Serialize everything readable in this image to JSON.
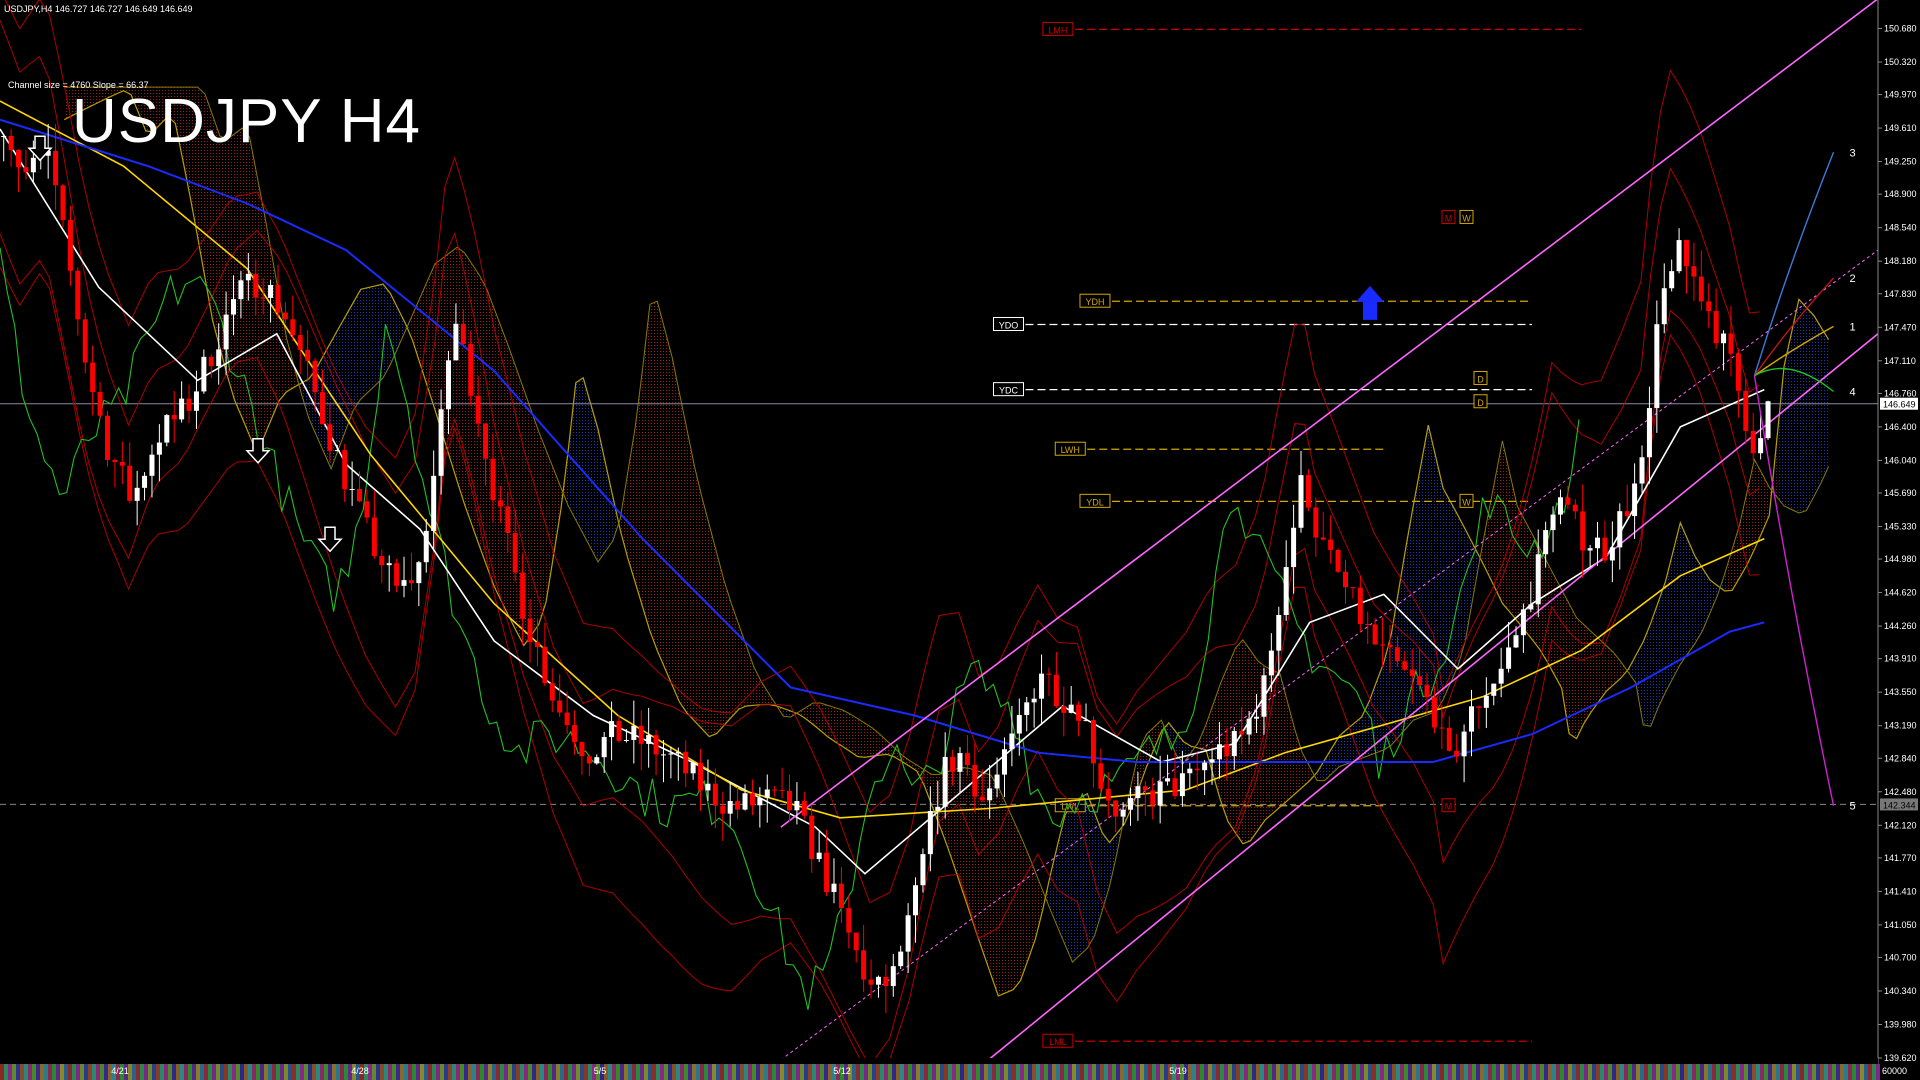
{
  "header": {
    "symbol_line": "USDJPY,H4  146.727 146.727 146.649 146.649",
    "channel_info": "Channel size = 4760 Slope = 66.37",
    "title": "USDJPY H4"
  },
  "colors": {
    "background": "#000000",
    "bull_candle": "#ffffff",
    "bear_candle": "#ff0000",
    "ema_white": "#ffffff",
    "ma_yellow": "#ffd700",
    "ma_blue": "#1a2bff",
    "bands_red": "#c00000",
    "chikou_green": "#22c022",
    "channel_magenta": "#ff66ff",
    "cloud_bull": "#1a3fcc",
    "cloud_bear": "#b02010",
    "level_red": "#cc0000",
    "level_gold": "#d4a800"
  },
  "chart_data": {
    "type": "candlestick",
    "symbol": "USDJPY",
    "timeframe": "H4",
    "ylim": [
      139.62,
      150.9
    ],
    "last_price": 146.649,
    "price_ticks": [
      "150.680",
      "150.320",
      "149.970",
      "149.610",
      "149.250",
      "148.900",
      "148.540",
      "148.180",
      "147.830",
      "147.470",
      "147.110",
      "146.760",
      "146.400",
      "146.040",
      "145.690",
      "145.330",
      "144.980",
      "144.620",
      "144.260",
      "143.910",
      "143.550",
      "143.190",
      "142.840",
      "142.480",
      "142.120",
      "141.770",
      "141.410",
      "141.050",
      "140.700",
      "140.340",
      "139.980",
      "139.620"
    ],
    "price_tag_current": "146.649",
    "price_tag_level": "142.344",
    "level_value": 142.344,
    "date_labels": [
      "4/21",
      "4/28",
      "5/5",
      "5/12",
      "5/19"
    ],
    "volume_label": "60000",
    "close_path": [
      [
        0,
        149.7
      ],
      [
        8,
        149.1
      ],
      [
        18,
        149.3
      ],
      [
        26,
        148.2
      ],
      [
        34,
        147.0
      ],
      [
        42,
        146.2
      ],
      [
        52,
        145.6
      ],
      [
        62,
        146.3
      ],
      [
        74,
        146.6
      ],
      [
        84,
        147.2
      ],
      [
        94,
        147.8
      ],
      [
        104,
        148.0
      ],
      [
        114,
        147.6
      ],
      [
        124,
        146.9
      ],
      [
        136,
        146.0
      ],
      [
        148,
        145.2
      ],
      [
        160,
        144.6
      ],
      [
        168,
        144.9
      ],
      [
        176,
        146.2
      ],
      [
        182,
        147.6
      ],
      [
        190,
        146.8
      ],
      [
        200,
        145.5
      ],
      [
        212,
        144.3
      ],
      [
        224,
        143.4
      ],
      [
        236,
        142.9
      ],
      [
        248,
        143.1
      ],
      [
        260,
        143.0
      ],
      [
        272,
        142.8
      ],
      [
        284,
        142.5
      ],
      [
        296,
        142.3
      ],
      [
        308,
        142.4
      ],
      [
        320,
        142.3
      ],
      [
        332,
        141.6
      ],
      [
        344,
        140.8
      ],
      [
        352,
        140.3
      ],
      [
        360,
        140.5
      ],
      [
        368,
        141.2
      ],
      [
        374,
        142.0
      ],
      [
        380,
        142.7
      ],
      [
        388,
        142.9
      ],
      [
        396,
        142.4
      ],
      [
        404,
        142.7
      ],
      [
        412,
        143.3
      ],
      [
        420,
        143.8
      ],
      [
        428,
        143.5
      ],
      [
        436,
        143.4
      ],
      [
        444,
        142.6
      ],
      [
        452,
        142.2
      ],
      [
        460,
        142.4
      ],
      [
        470,
        142.5
      ],
      [
        480,
        142.6
      ],
      [
        490,
        142.9
      ],
      [
        500,
        143.0
      ],
      [
        510,
        143.6
      ],
      [
        518,
        144.8
      ],
      [
        526,
        145.9
      ],
      [
        532,
        145.2
      ],
      [
        540,
        144.8
      ],
      [
        548,
        144.4
      ],
      [
        556,
        144.0
      ],
      [
        564,
        143.8
      ],
      [
        572,
        143.6
      ],
      [
        580,
        143.3
      ],
      [
        584,
        142.7
      ],
      [
        590,
        143.1
      ],
      [
        598,
        143.5
      ],
      [
        606,
        143.8
      ],
      [
        614,
        144.3
      ],
      [
        622,
        145.0
      ],
      [
        628,
        145.7
      ],
      [
        634,
        145.4
      ],
      [
        640,
        145.2
      ],
      [
        648,
        145.1
      ],
      [
        656,
        145.5
      ],
      [
        664,
        146.0
      ],
      [
        670,
        147.6
      ],
      [
        676,
        148.3
      ],
      [
        682,
        148.1
      ],
      [
        688,
        147.8
      ],
      [
        694,
        147.4
      ],
      [
        700,
        147.0
      ],
      [
        706,
        146.4
      ],
      [
        710,
        146.1
      ],
      [
        714,
        146.6
      ]
    ],
    "moving_averages": [
      {
        "name": "white",
        "values": [
          [
            0,
            149.6
          ],
          [
            40,
            147.9
          ],
          [
            80,
            146.9
          ],
          [
            112,
            147.4
          ],
          [
            140,
            146.0
          ],
          [
            170,
            145.3
          ],
          [
            200,
            144.1
          ],
          [
            240,
            143.3
          ],
          [
            280,
            142.8
          ],
          [
            330,
            142.1
          ],
          [
            350,
            141.6
          ],
          [
            390,
            142.5
          ],
          [
            430,
            143.4
          ],
          [
            470,
            142.8
          ],
          [
            500,
            143.0
          ],
          [
            530,
            144.3
          ],
          [
            560,
            144.6
          ],
          [
            590,
            143.8
          ],
          [
            620,
            144.5
          ],
          [
            650,
            145.0
          ],
          [
            680,
            146.4
          ],
          [
            714,
            146.8
          ]
        ]
      },
      {
        "name": "yellow",
        "values": [
          [
            0,
            149.9
          ],
          [
            50,
            149.2
          ],
          [
            100,
            148.1
          ],
          [
            150,
            146.1
          ],
          [
            200,
            144.5
          ],
          [
            250,
            143.3
          ],
          [
            300,
            142.5
          ],
          [
            340,
            142.2
          ],
          [
            400,
            142.3
          ],
          [
            440,
            142.4
          ],
          [
            480,
            142.5
          ],
          [
            520,
            142.9
          ],
          [
            560,
            143.2
          ],
          [
            600,
            143.5
          ],
          [
            640,
            144.0
          ],
          [
            680,
            144.8
          ],
          [
            714,
            145.2
          ]
        ]
      },
      {
        "name": "blue",
        "values": [
          [
            0,
            149.7
          ],
          [
            60,
            149.2
          ],
          [
            100,
            148.8
          ],
          [
            140,
            148.3
          ],
          [
            200,
            147.0
          ],
          [
            260,
            145.2
          ],
          [
            320,
            143.6
          ],
          [
            370,
            143.3
          ],
          [
            420,
            142.9
          ],
          [
            460,
            142.8
          ],
          [
            500,
            142.8
          ],
          [
            540,
            142.8
          ],
          [
            580,
            142.8
          ],
          [
            620,
            143.1
          ],
          [
            660,
            143.6
          ],
          [
            700,
            144.2
          ],
          [
            714,
            144.3
          ]
        ]
      }
    ],
    "channel_lines": [
      {
        "name": "upper",
        "p1": [
          316,
          142.1
        ],
        "p2": [
          760,
          151.0
        ]
      },
      {
        "name": "middle",
        "p1": [
          316,
          139.6
        ],
        "p2": [
          760,
          148.3
        ]
      },
      {
        "name": "lower",
        "p1": [
          400,
          139.6
        ],
        "p2": [
          760,
          147.4
        ]
      }
    ],
    "projection": {
      "origin": [
        710,
        146.95
      ],
      "points": [
        {
          "label": "3",
          "value": 149.35
        },
        {
          "label": "2",
          "value": 148.0
        },
        {
          "label": "1",
          "value": 147.48
        },
        {
          "label": "4",
          "value": 146.78
        },
        {
          "label": "5",
          "value": 142.33
        }
      ]
    },
    "levels": [
      {
        "label": "LMH",
        "value": 150.67,
        "kind": "red"
      },
      {
        "label": "YDH",
        "value": 147.75,
        "kind": "gold"
      },
      {
        "label": "YDO",
        "value": 147.5,
        "kind": "white"
      },
      {
        "label": "YDC",
        "value": 146.8,
        "kind": "white"
      },
      {
        "label": "LWH",
        "value": 146.16,
        "kind": "gold"
      },
      {
        "label": "YDL",
        "value": 145.6,
        "kind": "gold"
      },
      {
        "label": "LWL",
        "value": 142.33,
        "kind": "gold"
      },
      {
        "label": "LML",
        "value": 139.8,
        "kind": "red"
      }
    ],
    "markers": [
      {
        "label": "M",
        "value": 148.65
      },
      {
        "label": "W",
        "value": 148.65
      },
      {
        "label": "D",
        "value": 146.92
      },
      {
        "label": "D",
        "value": 146.67
      },
      {
        "label": "W",
        "value": 145.6
      },
      {
        "label": "M",
        "value": 142.33
      }
    ],
    "arrows": [
      {
        "dir": "down",
        "value": 149.35
      },
      {
        "dir": "down",
        "value": 146.1
      },
      {
        "dir": "down",
        "value": 145.15
      },
      {
        "dir": "up",
        "value": 147.7
      }
    ]
  }
}
